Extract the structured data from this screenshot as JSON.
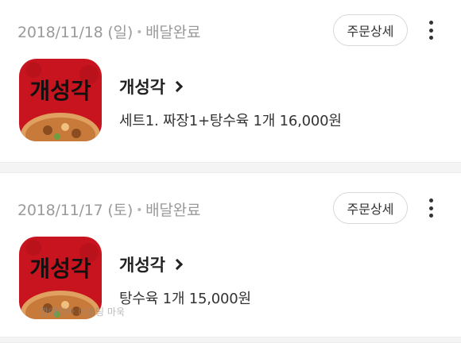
{
  "orders": [
    {
      "date": "2018/11/18 (일)",
      "status": "배달완료",
      "detail_label": "주문상세",
      "store": {
        "name": "개성각",
        "logo_text": "개성각"
      },
      "items": "세트1. 짜장1+탕수육 1개 16,000원"
    },
    {
      "date": "2018/11/17 (토)",
      "status": "배달완료",
      "detail_label": "주문상세",
      "store": {
        "name": "개성각",
        "logo_text": "개성각"
      },
      "items": "탕수육 1개 15,000원"
    }
  ],
  "watermark": "깐에리아 버블딩 마욱",
  "colors": {
    "logo_red": "#c8141e",
    "logo_text": "#111111",
    "status_gray": "#9a9a9a"
  }
}
